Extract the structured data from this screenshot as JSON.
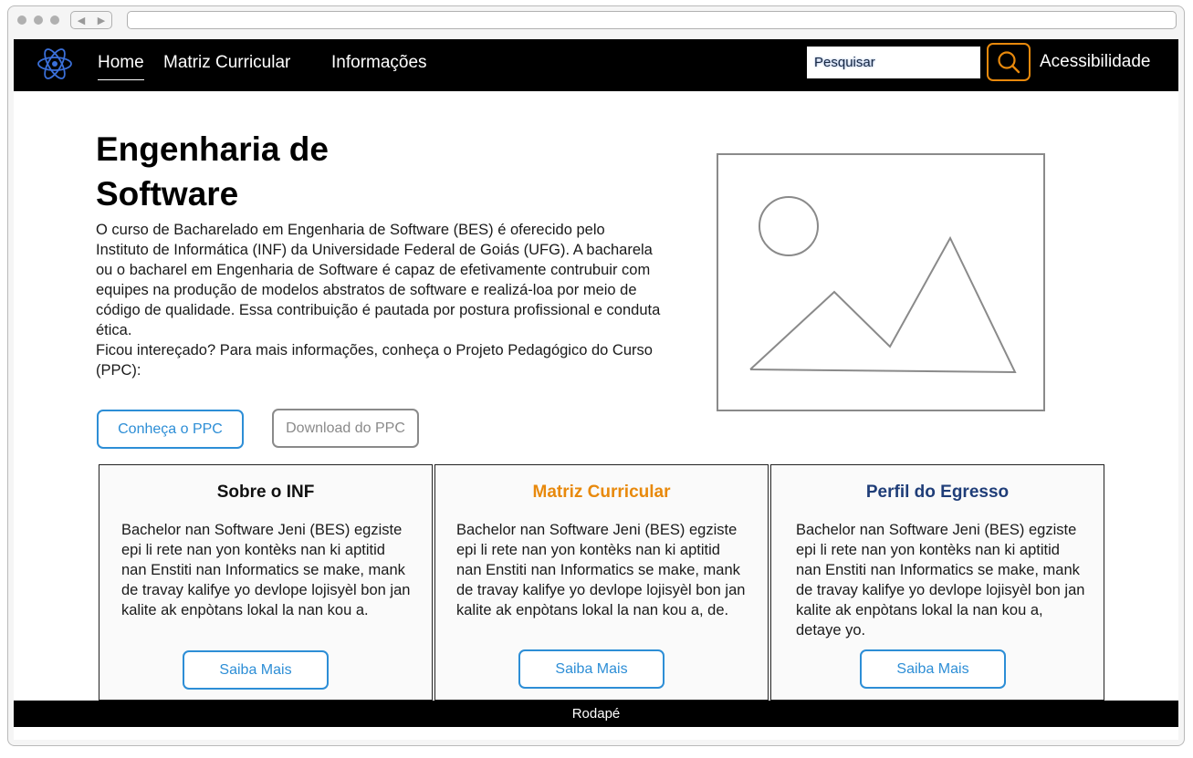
{
  "nav": {
    "home": "Home",
    "matriz": "Matriz Curricular",
    "informacoes": "Informações",
    "search_placeholder": "Pesquisar",
    "acessibilidade": "Acessibilidade"
  },
  "hero": {
    "title": "Engenharia de Software",
    "paragraph": "O curso de Bacharelado em Engenharia de Software (BES) é oferecido pelo Instituto de Informática (INF) da Universidade Federal de Goiás (UFG). A bacharela ou o bacharel em Engenharia de Software é capaz de efetivamente contrubuir com equipes na produção de modelos abstratos de software e realizá-loa por meio de código de qualidade. Essa contribuição é pautada por postura profissional e conduta ética.",
    "cta_text": "Ficou intereçado? Para mais informações, conheça o Projeto Pedagógico do Curso (PPC):",
    "btn_conheca": "Conheça o PPC",
    "btn_download": "Download do PPC"
  },
  "cards": [
    {
      "title": "Sobre o INF",
      "title_color": "#111111",
      "text": "Bachelor nan Software Jeni (BES) egziste epi li rete nan yon kontèks nan ki aptitid nan Enstiti nan Informatics se make, mank de travay kalifye yo devlope lojisyèl bon jan kalite ak enpòtans lokal la nan kou a.",
      "button": "Saiba Mais"
    },
    {
      "title": "Matriz Curricular",
      "title_color": "#e8890c",
      "text": "Bachelor nan Software Jeni (BES) egziste epi li rete nan yon kontèks nan ki aptitid nan Enstiti nan Informatics se make, mank de travay kalifye yo devlope lojisyèl bon jan kalite ak enpòtans lokal la nan kou a, de.",
      "button": "Saiba Mais"
    },
    {
      "title": "Perfil do Egresso",
      "title_color": "#1f3d78",
      "text": "Bachelor nan Software Jeni (BES) egziste epi li rete nan yon kontèks nan ki aptitid nan Enstiti nan Informatics se make, mank de travay kalifye yo devlope lojisyèl bon jan kalite ak enpòtans lokal la nan kou a, detaye yo.",
      "button": "Saiba Mais"
    }
  ],
  "footer": {
    "text": "Rodapé"
  },
  "icons": {
    "logo": "atom-icon",
    "search": "search-icon",
    "image": "image-placeholder-icon"
  },
  "colors": {
    "accent_orange": "#e8890c",
    "accent_blue": "#2d8ed6",
    "navy": "#1f3d78",
    "nav_bg": "#000000"
  }
}
